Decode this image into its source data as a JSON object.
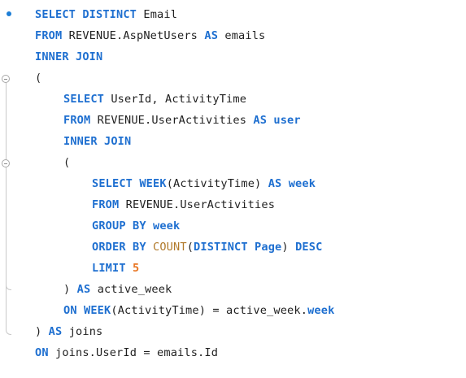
{
  "colors": {
    "keyword": "#1e6fd0",
    "identifier": "#1f1f1f",
    "aggregate_function": "#b17a2b",
    "number": "#e8731e",
    "breakpoint": "#1e7ed6"
  },
  "icons": [
    "breakpoint-dot-icon",
    "fold-collapse-icon"
  ],
  "lines": [
    {
      "tokens": [
        {
          "t": "SELECT DISTINCT ",
          "k": "kw"
        },
        {
          "t": "Email",
          "k": "plain"
        }
      ]
    },
    {
      "tokens": [
        {
          "t": "FROM ",
          "k": "kw"
        },
        {
          "t": "REVENUE.AspNetUsers ",
          "k": "plain"
        },
        {
          "t": "AS ",
          "k": "kw"
        },
        {
          "t": "emails",
          "k": "plain"
        }
      ]
    },
    {
      "tokens": [
        {
          "t": "INNER JOIN",
          "k": "kw"
        }
      ]
    },
    {
      "tokens": [
        {
          "t": "(",
          "k": "plain"
        }
      ]
    },
    {
      "tokens": [
        {
          "t": "SELECT ",
          "k": "kw"
        },
        {
          "t": "UserId, ActivityTime",
          "k": "plain"
        }
      ]
    },
    {
      "tokens": [
        {
          "t": "FROM ",
          "k": "kw"
        },
        {
          "t": "REVENUE.UserActivities ",
          "k": "plain"
        },
        {
          "t": "AS user",
          "k": "kw"
        }
      ]
    },
    {
      "tokens": [
        {
          "t": "INNER JOIN",
          "k": "kw"
        }
      ]
    },
    {
      "tokens": [
        {
          "t": "(",
          "k": "plain"
        }
      ]
    },
    {
      "tokens": [
        {
          "t": "SELECT WEEK",
          "k": "kw"
        },
        {
          "t": "(ActivityTime) ",
          "k": "plain"
        },
        {
          "t": "AS week",
          "k": "kw"
        }
      ]
    },
    {
      "tokens": [
        {
          "t": "FROM ",
          "k": "kw"
        },
        {
          "t": "REVENUE.UserActivities",
          "k": "plain"
        }
      ]
    },
    {
      "tokens": [
        {
          "t": "GROUP BY week",
          "k": "kw"
        }
      ]
    },
    {
      "tokens": [
        {
          "t": "ORDER BY ",
          "k": "kw"
        },
        {
          "t": "COUNT",
          "k": "agg"
        },
        {
          "t": "(",
          "k": "plain"
        },
        {
          "t": "DISTINCT ",
          "k": "kw"
        },
        {
          "t": "Page",
          "k": "kw"
        },
        {
          "t": ") ",
          "k": "plain"
        },
        {
          "t": "DESC",
          "k": "kw"
        }
      ]
    },
    {
      "tokens": [
        {
          "t": "LIMIT ",
          "k": "kw"
        },
        {
          "t": "5",
          "k": "num"
        }
      ]
    },
    {
      "tokens": [
        {
          "t": ") ",
          "k": "plain"
        },
        {
          "t": "AS ",
          "k": "kw"
        },
        {
          "t": "active_week",
          "k": "plain"
        }
      ]
    },
    {
      "tokens": [
        {
          "t": "ON ",
          "k": "kw"
        },
        {
          "t": "WEEK",
          "k": "kw"
        },
        {
          "t": "(ActivityTime) = active_week.",
          "k": "plain"
        },
        {
          "t": "week",
          "k": "kw"
        }
      ]
    },
    {
      "tokens": [
        {
          "t": ") ",
          "k": "plain"
        },
        {
          "t": "AS ",
          "k": "kw"
        },
        {
          "t": "joins",
          "k": "plain"
        }
      ]
    },
    {
      "tokens": [
        {
          "t": "ON ",
          "k": "kw"
        },
        {
          "t": "joins.UserId = emails.Id",
          "k": "plain"
        }
      ]
    }
  ]
}
